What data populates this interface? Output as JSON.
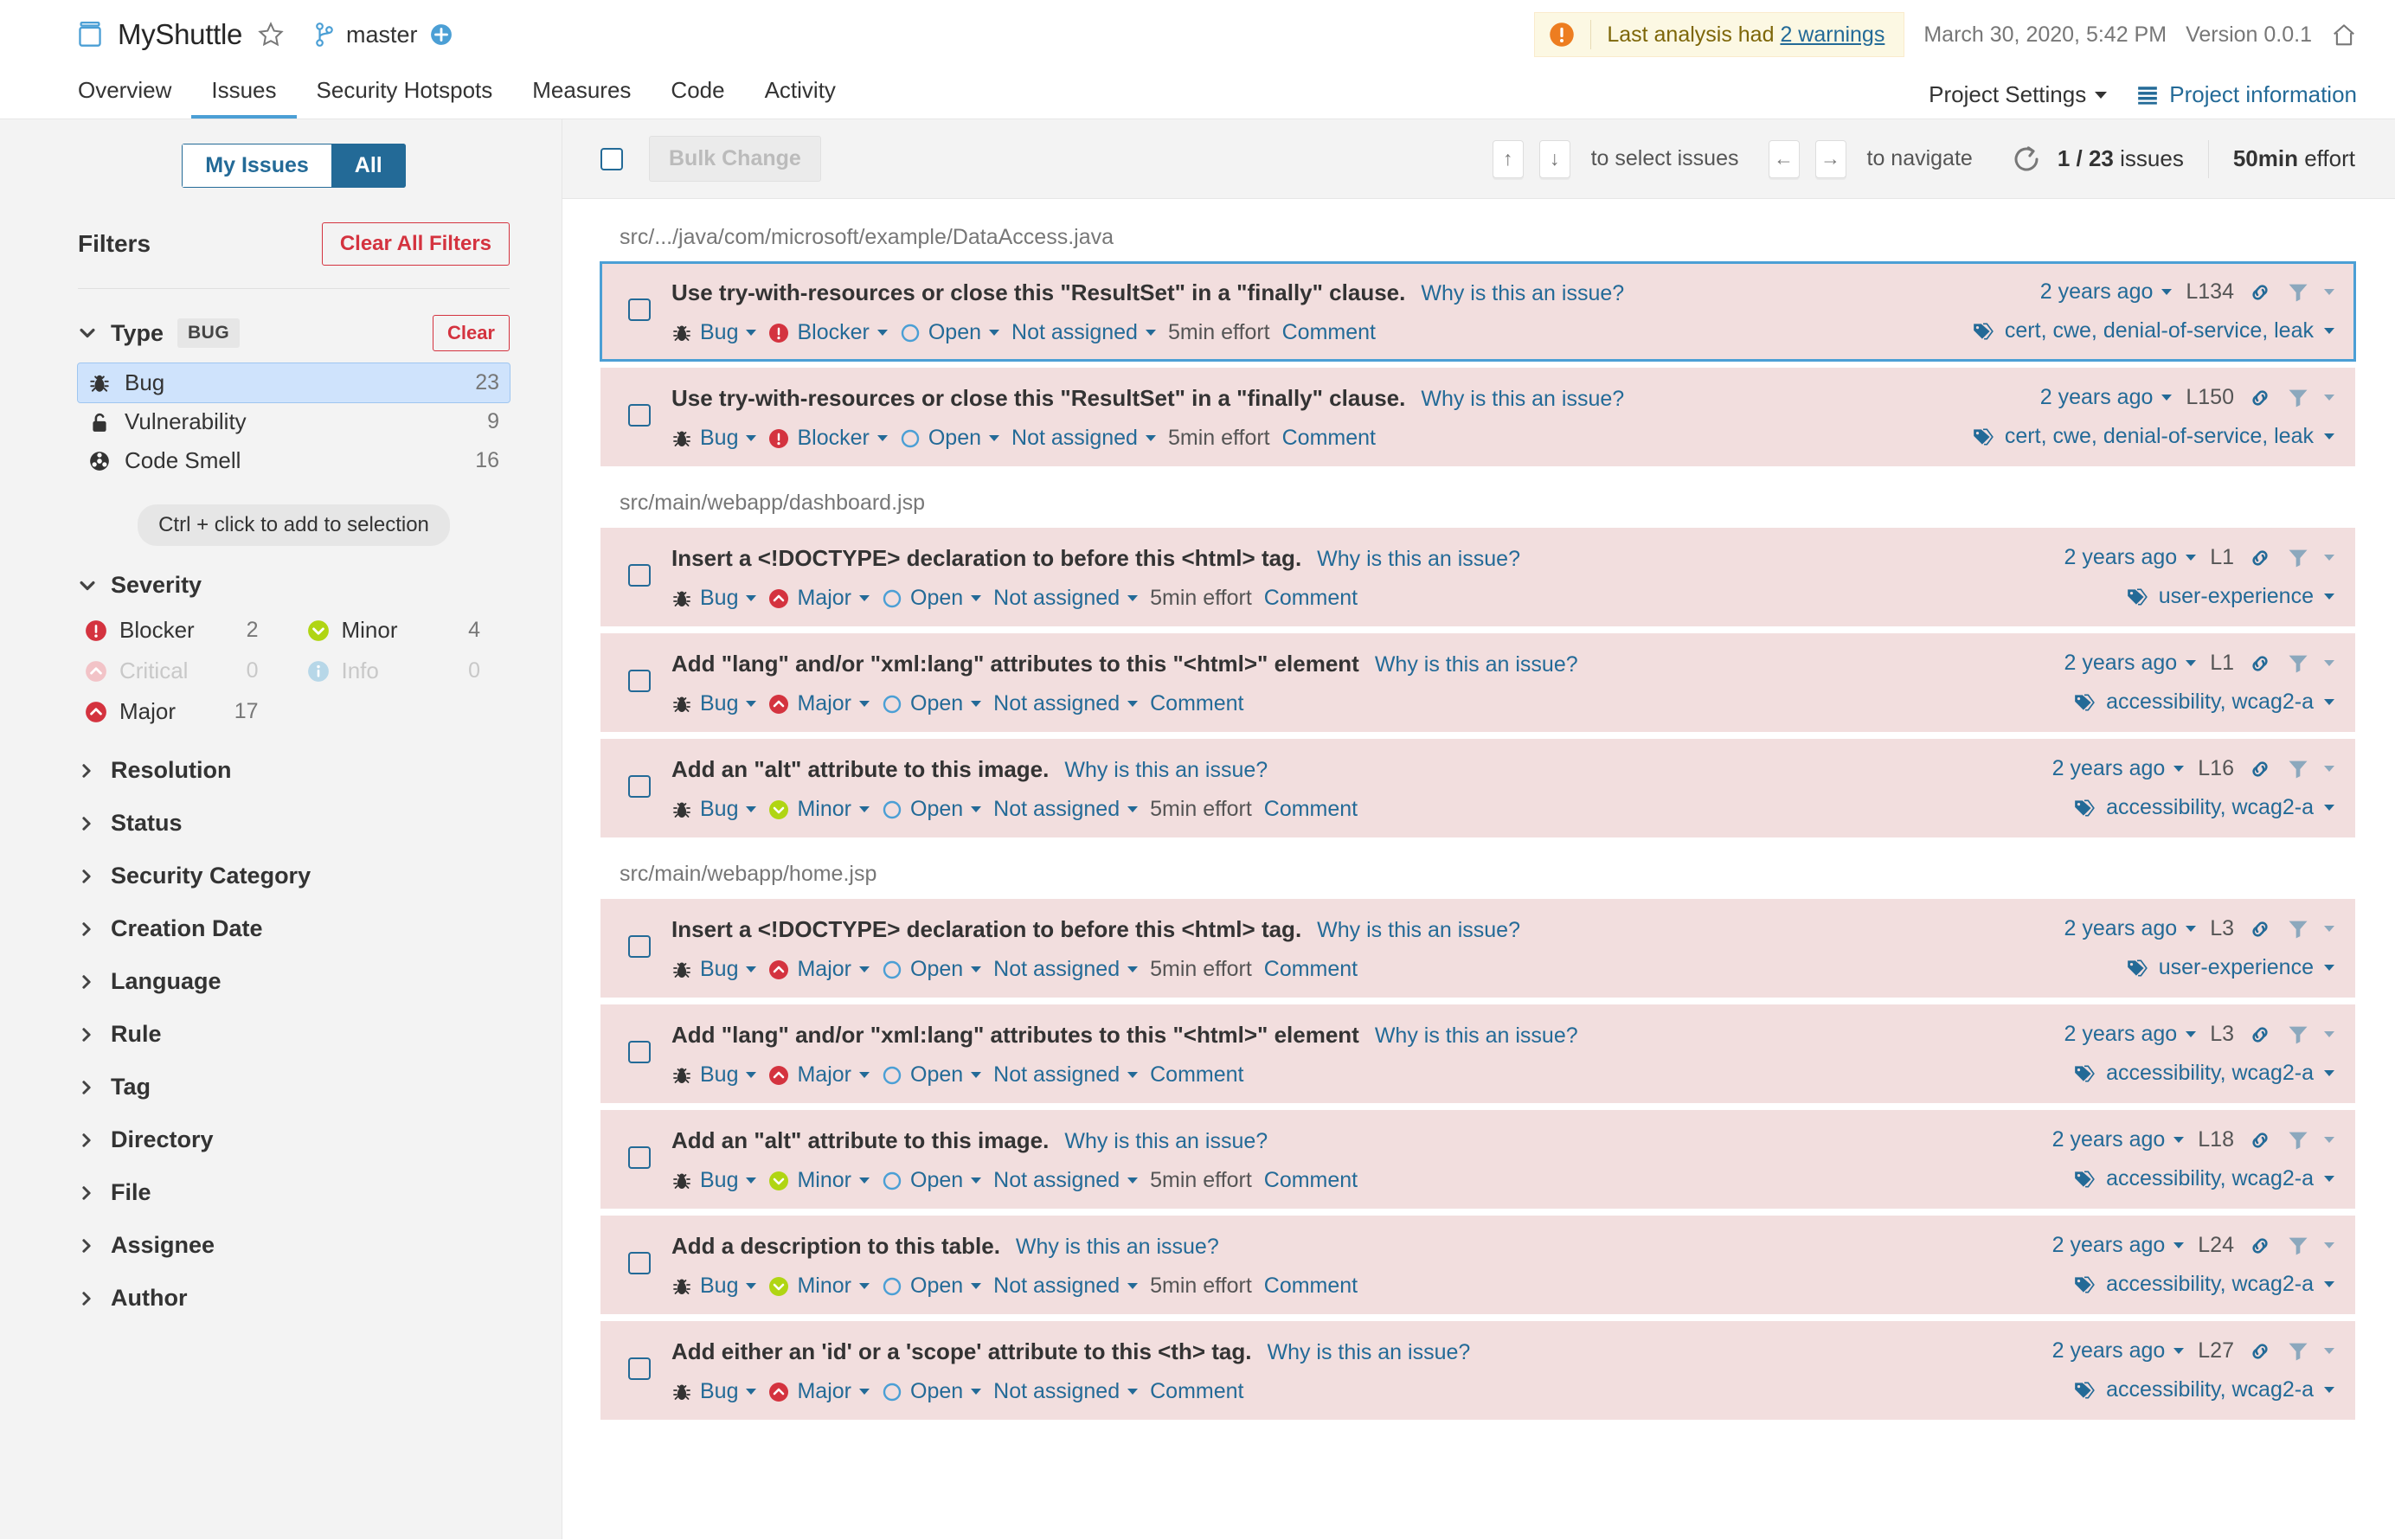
{
  "header": {
    "project_icon": "project-icon",
    "project_name": "MyShuttle",
    "favorite_icon": "star-icon",
    "branch_icon": "branch-icon",
    "branch_name": "master",
    "branch_add_icon": "plus-circle-icon",
    "warning_icon": "warning-icon",
    "warning_prefix": "Last analysis had ",
    "warning_link": "2 warnings",
    "analysis_date": "March 30, 2020, 5:42 PM",
    "version": "Version 0.0.1",
    "home_icon": "home-icon"
  },
  "nav": {
    "tabs": [
      {
        "label": "Overview",
        "active": false
      },
      {
        "label": "Issues",
        "active": true
      },
      {
        "label": "Security Hotspots",
        "active": false
      },
      {
        "label": "Measures",
        "active": false
      },
      {
        "label": "Code",
        "active": false
      },
      {
        "label": "Activity",
        "active": false
      }
    ],
    "project_settings": "Project Settings",
    "project_information": "Project information",
    "project_information_icon": "list-icon"
  },
  "sidebar": {
    "scope_my_issues": "My Issues",
    "scope_all": "All",
    "filters_title": "Filters",
    "clear_all_filters": "Clear All Filters",
    "type_facet": {
      "name": "Type",
      "badge": "BUG",
      "clear": "Clear",
      "items": [
        {
          "icon": "bug-icon",
          "label": "Bug",
          "count": "23",
          "selected": true
        },
        {
          "icon": "vulnerability-icon",
          "label": "Vulnerability",
          "count": "9",
          "selected": false
        },
        {
          "icon": "code-smell-icon",
          "label": "Code Smell",
          "count": "16",
          "selected": false
        }
      ]
    },
    "hint": "Ctrl + click to add to selection",
    "severity_facet": {
      "name": "Severity",
      "items": [
        {
          "icon": "blocker-icon",
          "label": "Blocker",
          "count": "2",
          "dim": false
        },
        {
          "icon": "minor-icon",
          "label": "Minor",
          "count": "4",
          "dim": false
        },
        {
          "icon": "critical-icon",
          "label": "Critical",
          "count": "0",
          "dim": true
        },
        {
          "icon": "info-icon",
          "label": "Info",
          "count": "0",
          "dim": true
        },
        {
          "icon": "major-icon",
          "label": "Major",
          "count": "17",
          "dim": false
        }
      ]
    },
    "collapsed_facets": [
      "Resolution",
      "Status",
      "Security Category",
      "Creation Date",
      "Language",
      "Rule",
      "Tag",
      "Directory",
      "File",
      "Assignee",
      "Author"
    ]
  },
  "toolbar": {
    "select_all_checkbox": "select-all",
    "bulk_change": "Bulk Change",
    "key_up": "↑",
    "key_down": "↓",
    "select_hint": "to select issues",
    "key_left": "←",
    "key_right": "→",
    "navigate_hint": "to navigate",
    "refresh_icon": "refresh-icon",
    "issue_position": "1 / 23",
    "issues_label": "issues",
    "effort_value": "50min",
    "effort_label": "effort"
  },
  "issue_groups": [
    {
      "file": "src/.../java/com/microsoft/example/DataAccess.java",
      "issues": [
        {
          "message": "Use try-with-resources or close this \"ResultSet\" in a \"finally\" clause.",
          "why": "Why is this an issue?",
          "type": "Bug",
          "type_icon": "bug-icon",
          "severity": "Blocker",
          "severity_icon": "blocker-icon",
          "status": "Open",
          "status_icon": "open-icon",
          "assignee": "Not assigned",
          "effort": "5min effort",
          "comment": "Comment",
          "ago": "2 years ago",
          "line": "L134",
          "tags": "cert, cwe, denial-of-service, leak",
          "selected": true
        },
        {
          "message": "Use try-with-resources or close this \"ResultSet\" in a \"finally\" clause.",
          "why": "Why is this an issue?",
          "type": "Bug",
          "type_icon": "bug-icon",
          "severity": "Blocker",
          "severity_icon": "blocker-icon",
          "status": "Open",
          "status_icon": "open-icon",
          "assignee": "Not assigned",
          "effort": "5min effort",
          "comment": "Comment",
          "ago": "2 years ago",
          "line": "L150",
          "tags": "cert, cwe, denial-of-service, leak",
          "selected": false
        }
      ]
    },
    {
      "file": "src/main/webapp/dashboard.jsp",
      "issues": [
        {
          "message": "Insert a <!DOCTYPE> declaration to before this <html> tag.",
          "why": "Why is this an issue?",
          "type": "Bug",
          "type_icon": "bug-icon",
          "severity": "Major",
          "severity_icon": "major-icon",
          "status": "Open",
          "status_icon": "open-icon",
          "assignee": "Not assigned",
          "effort": "5min effort",
          "comment": "Comment",
          "ago": "2 years ago",
          "line": "L1",
          "tags": "user-experience",
          "selected": false
        },
        {
          "message": "Add \"lang\" and/or \"xml:lang\" attributes to this \"<html>\" element",
          "why": "Why is this an issue?",
          "type": "Bug",
          "type_icon": "bug-icon",
          "severity": "Major",
          "severity_icon": "major-icon",
          "status": "Open",
          "status_icon": "open-icon",
          "assignee": "Not assigned",
          "effort": "",
          "comment": "Comment",
          "ago": "2 years ago",
          "line": "L1",
          "tags": "accessibility, wcag2-a",
          "selected": false
        },
        {
          "message": "Add an \"alt\" attribute to this image.",
          "why": "Why is this an issue?",
          "type": "Bug",
          "type_icon": "bug-icon",
          "severity": "Minor",
          "severity_icon": "minor-icon",
          "status": "Open",
          "status_icon": "open-icon",
          "assignee": "Not assigned",
          "effort": "5min effort",
          "comment": "Comment",
          "ago": "2 years ago",
          "line": "L16",
          "tags": "accessibility, wcag2-a",
          "selected": false
        }
      ]
    },
    {
      "file": "src/main/webapp/home.jsp",
      "issues": [
        {
          "message": "Insert a <!DOCTYPE> declaration to before this <html> tag.",
          "why": "Why is this an issue?",
          "type": "Bug",
          "type_icon": "bug-icon",
          "severity": "Major",
          "severity_icon": "major-icon",
          "status": "Open",
          "status_icon": "open-icon",
          "assignee": "Not assigned",
          "effort": "5min effort",
          "comment": "Comment",
          "ago": "2 years ago",
          "line": "L3",
          "tags": "user-experience",
          "selected": false
        },
        {
          "message": "Add \"lang\" and/or \"xml:lang\" attributes to this \"<html>\" element",
          "why": "Why is this an issue?",
          "type": "Bug",
          "type_icon": "bug-icon",
          "severity": "Major",
          "severity_icon": "major-icon",
          "status": "Open",
          "status_icon": "open-icon",
          "assignee": "Not assigned",
          "effort": "",
          "comment": "Comment",
          "ago": "2 years ago",
          "line": "L3",
          "tags": "accessibility, wcag2-a",
          "selected": false
        },
        {
          "message": "Add an \"alt\" attribute to this image.",
          "why": "Why is this an issue?",
          "type": "Bug",
          "type_icon": "bug-icon",
          "severity": "Minor",
          "severity_icon": "minor-icon",
          "status": "Open",
          "status_icon": "open-icon",
          "assignee": "Not assigned",
          "effort": "5min effort",
          "comment": "Comment",
          "ago": "2 years ago",
          "line": "L18",
          "tags": "accessibility, wcag2-a",
          "selected": false
        },
        {
          "message": "Add a description to this table.",
          "why": "Why is this an issue?",
          "type": "Bug",
          "type_icon": "bug-icon",
          "severity": "Minor",
          "severity_icon": "minor-icon",
          "status": "Open",
          "status_icon": "open-icon",
          "assignee": "Not assigned",
          "effort": "5min effort",
          "comment": "Comment",
          "ago": "2 years ago",
          "line": "L24",
          "tags": "accessibility, wcag2-a",
          "selected": false
        },
        {
          "message": "Add either an 'id' or a 'scope' attribute to this <th> tag.",
          "why": "Why is this an issue?",
          "type": "Bug",
          "type_icon": "bug-icon",
          "severity": "Major",
          "severity_icon": "major-icon",
          "status": "Open",
          "status_icon": "open-icon",
          "assignee": "Not assigned",
          "effort": "",
          "comment": "Comment",
          "ago": "2 years ago",
          "line": "L27",
          "tags": "accessibility, wcag2-a",
          "selected": false
        }
      ]
    }
  ],
  "colors": {
    "accent_blue": "#4b9fd5",
    "link_blue": "#236a97",
    "issue_bg": "#f2dede",
    "blocker_red": "#d4333f",
    "major_red": "#d4333f",
    "minor_green": "#b0d513",
    "info_blue": "#b7d7e8",
    "warning_orange": "#ed7d20",
    "sidebar_bg": "#f3f3f3",
    "selected_facet_bg": "#cfe3fc"
  }
}
